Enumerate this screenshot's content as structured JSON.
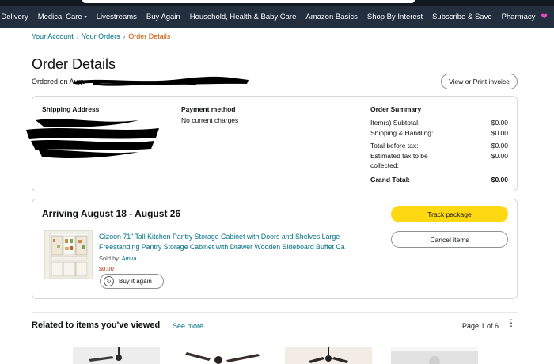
{
  "nav": {
    "items": [
      {
        "label": "y Delivery"
      },
      {
        "label": "Medical Care",
        "caret": "▾"
      },
      {
        "label": "Livestreams"
      },
      {
        "label": "Buy Again"
      },
      {
        "label": "Household, Health & Baby Care"
      },
      {
        "label": "Amazon Basics"
      },
      {
        "label": "Shop By Interest"
      },
      {
        "label": "Subscribe & Save"
      },
      {
        "label": "Pharmacy"
      }
    ],
    "gift_icon": "gift-icon",
    "gift_glyph": "❤"
  },
  "breadcrumb": {
    "items": [
      "Your Account",
      "Your Orders"
    ],
    "separator": "›",
    "current": "Order Details"
  },
  "order": {
    "title": "Order Details",
    "ordered_on_prefix": "Ordered on Augu",
    "invoice_label": "View or Print invoice"
  },
  "summary": {
    "shipping_label": "Shipping Address",
    "payment_label": "Payment method",
    "payment_value": "No current charges",
    "order_summary_label": "Order Summary",
    "rows": [
      {
        "label": "Item(s) Subtotal:",
        "value": "$0.00"
      },
      {
        "label": "Shipping & Handling:",
        "value": "$0.00"
      },
      {
        "label": "Total before tax:",
        "value": "$0.00"
      },
      {
        "label": "Estimated tax to be collected:",
        "value": "$0.00"
      }
    ],
    "grand_total_label": "Grand Total:",
    "grand_total_value": "$0.00"
  },
  "shipment": {
    "arriving": "Arriving August 18 - August 26",
    "product_title": "Gizoon 71\" Tall Kitchen Pantry Storage Cabinet with Doors and Shelves Large Freestanding Pantry Storage Cabinet with Drawer Wooden Sideboard Buffet Ca",
    "sold_by_label": "Sold by:",
    "seller": "Airiva",
    "price": "$0.00",
    "buy_again_label": "Buy it again",
    "track_label": "Track package",
    "cancel_label": "Cancel items"
  },
  "related": {
    "title": "Related to items you've viewed",
    "see_more": "See more",
    "page_indicator": "Page 1 of 6",
    "kebab_glyph": "⋮"
  },
  "colors": {
    "nav_bg": "#232f3e",
    "link": "#007185",
    "breadcrumb_current": "#c45500",
    "primary_button": "#ffd814",
    "price": "#b12704"
  }
}
